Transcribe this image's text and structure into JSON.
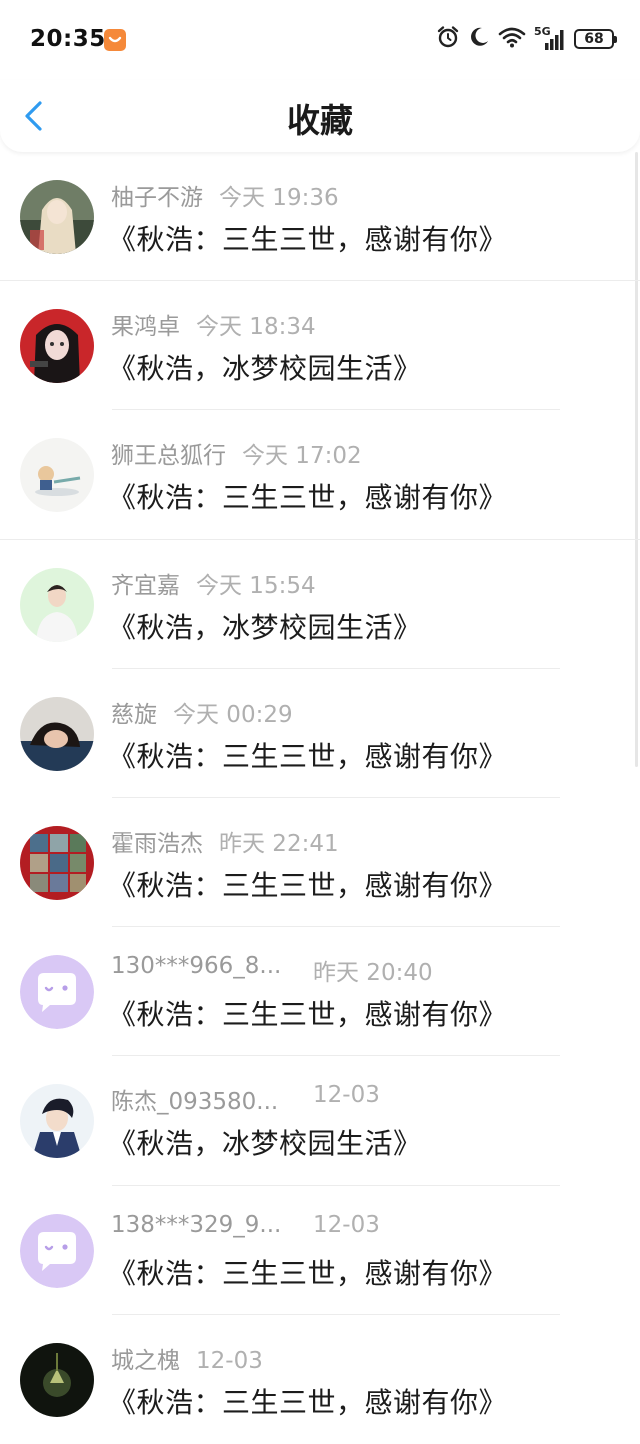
{
  "status_bar": {
    "time": "20:35",
    "network": "5G",
    "battery": "68",
    "icons": [
      "alarm-icon",
      "moon-icon",
      "wifi-icon",
      "signal-icon"
    ]
  },
  "header": {
    "title": "收藏",
    "back_icon": "chevron-left-icon"
  },
  "colors": {
    "accent": "#2f9bf0",
    "meta_text": "#9a9a9a",
    "title_text": "#1c1c1c"
  },
  "items": [
    {
      "name": "柚子不游",
      "time": "今天 19:36",
      "title": "《秋浩：三生三世，感谢有你》"
    },
    {
      "name": "果鸿卓",
      "time": "今天 18:34",
      "title": "《秋浩，冰梦校园生活》"
    },
    {
      "name": "狮王总狐行",
      "time": "今天 17:02",
      "title": "《秋浩：三生三世，感谢有你》"
    },
    {
      "name": "齐宜嘉",
      "time": "今天 15:54",
      "title": "《秋浩，冰梦校园生活》"
    },
    {
      "name": "慈旋",
      "time": "今天 00:29",
      "title": "《秋浩：三生三世，感谢有你》"
    },
    {
      "name": "霍雨浩杰",
      "time": "昨天 22:41",
      "title": "《秋浩：三生三世，感谢有你》"
    },
    {
      "name": "130***966_8...",
      "time": "昨天 20:40",
      "title": "《秋浩：三生三世，感谢有你》"
    },
    {
      "name": "陈杰_093580...",
      "time": "12-03",
      "title": "《秋浩，冰梦校园生活》"
    },
    {
      "name": "138***329_9...",
      "time": "12-03",
      "title": "《秋浩：三生三世，感谢有你》"
    },
    {
      "name": "城之槐",
      "time": "12-03",
      "title": "《秋浩：三生三世，感谢有你》"
    }
  ]
}
